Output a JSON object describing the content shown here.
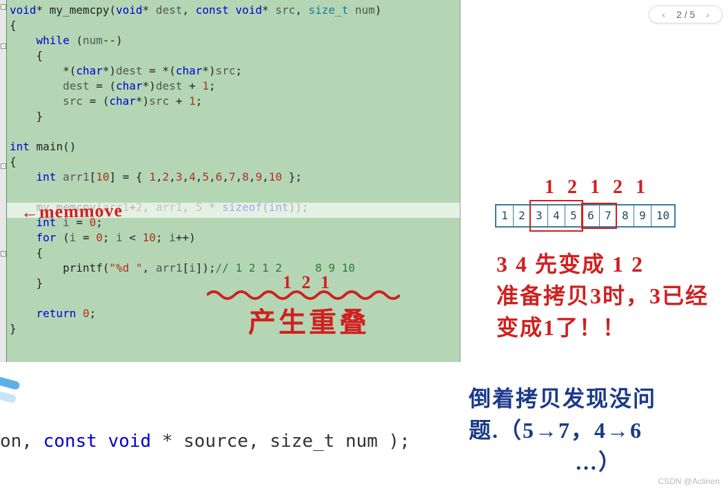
{
  "code": {
    "line1": "void* my_memcpy(void* dest, const void* src, size_t num)",
    "line2": "{",
    "line3": "    while (num--)",
    "line4": "    {",
    "line5": "        *(char*)dest = *(char*)src;",
    "line6": "        dest = (char*)dest + 1;",
    "line7": "        src = (char*)src + 1;",
    "line8": "    }",
    "line9": "",
    "line10": "int main()",
    "line11": "{",
    "line12": "    int arr1[10] = { 1,2,3,4,5,6,7,8,9,10 };",
    "line13": "",
    "line14": "    my_memcpy(arr1+2, arr1, 5 * sizeof(int));",
    "line15": "    int i = 0;",
    "line16": "    for (i = 0; i < 10; i++)",
    "line17": "    {",
    "line18a": "        printf(\"%d \", arr1[i]);",
    "line18b": "// 1 2 1 2     8 9 10",
    "line19": "    }",
    "line20": "",
    "line21": "    return 0;",
    "line22": "}"
  },
  "annotations": {
    "memmove": "←memmove",
    "digits121": "1 2 1",
    "overlap": "产生重叠",
    "top12121": "1 2 1 2 1",
    "note_line1": "3 4 先变成 1 2",
    "note_line2": "准备拷贝3时，3已经",
    "note_line3": "变成1了！！",
    "blue_line1": "倒着拷贝发现没问",
    "blue_line2": "题.（5→7，4→6",
    "blue_line3": "…）"
  },
  "array": [
    "1",
    "2",
    "3",
    "4",
    "5",
    "6",
    "7",
    "8",
    "9",
    "10"
  ],
  "pager": {
    "prev": "‹",
    "label": "2 / 5",
    "next": "›"
  },
  "bottom_signature": "on, const void * source, size_t num );",
  "watermark": "CSDN @Actinen"
}
